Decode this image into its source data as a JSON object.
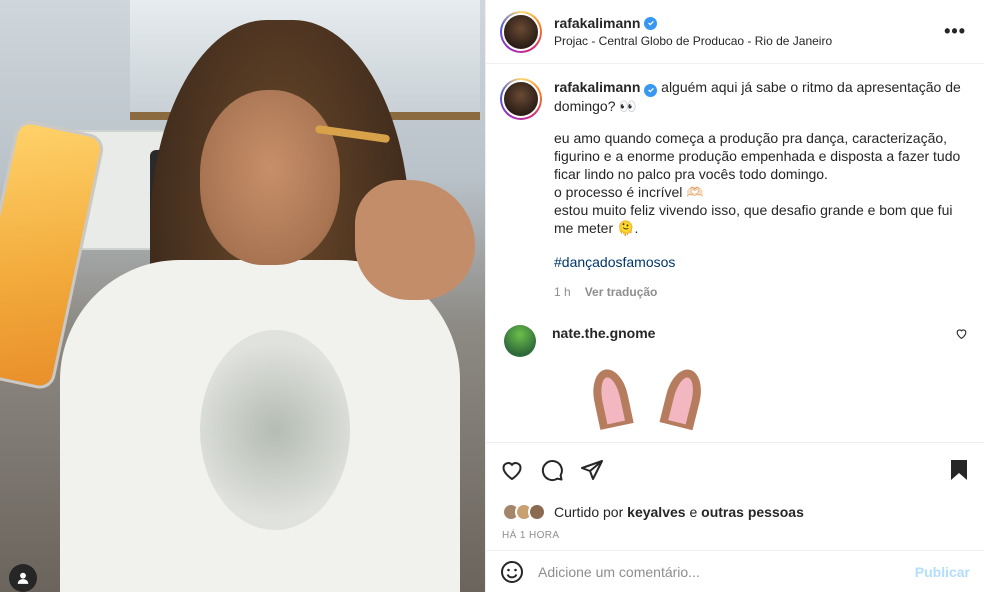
{
  "post": {
    "author": "rafakalimann",
    "location": "Projac - Central Globo de Producao - Rio de Janeiro",
    "more_label": "•••"
  },
  "caption": {
    "username": "rafakalimann",
    "line1": "alguém aqui já sabe o ritmo da apresentação de domingo? 👀",
    "para1": "eu amo quando começa a produção pra dança, caracterização, figurino e a enorme produção empenhada e disposta a fazer tudo ficar lindo no palco pra vocês todo domingo.",
    "para2": "o processo é incrível 🫶🏻",
    "para3": "estou muito feliz vivendo isso, que desafio grande e bom que fui me meter 🫠.",
    "hashtag": "#dançadosfamosos",
    "time": "1 h",
    "translate": "Ver tradução"
  },
  "comment": {
    "username": "nate.the.gnome"
  },
  "likes": {
    "prefix": "Curtido por",
    "user": "keyalves",
    "middle": "e",
    "others": "outras pessoas"
  },
  "timestamp": "HÁ 1 HORA",
  "add_comment": {
    "placeholder": "Adicione um comentário...",
    "publish": "Publicar"
  },
  "colors": {
    "verified": "#3897f0",
    "link": "#00376b",
    "publish_disabled": "#b2dffc"
  },
  "icons": [
    "user-tag-icon",
    "verified-icon",
    "more-icon",
    "heart-icon",
    "comment-icon",
    "share-icon",
    "save-icon",
    "emoji-icon"
  ]
}
